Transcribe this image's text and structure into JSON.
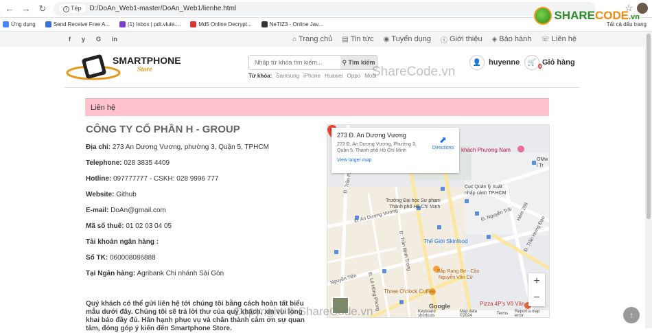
{
  "browser": {
    "url_chip": "Tệp",
    "url": "D:/DoAn_Web1-master/DoAn_Web1/lienhe.html",
    "bookmarks": [
      {
        "label": "Ứng dụng",
        "color": "#4285f4"
      },
      {
        "label": "Send Receive Free A...",
        "color": "#3b6fd9"
      },
      {
        "label": "(1) Inbox | pdt.vlute....",
        "color": "#7b3fd6"
      },
      {
        "label": "Md5 Online Decrypt...",
        "color": "#d33"
      },
      {
        "label": "NeTIZ3 - Online Jav...",
        "color": "#333"
      }
    ],
    "all_bookmarks": "Tất cả dấu trang"
  },
  "brand_logo": {
    "main": "SHARE",
    "accent": "CODE",
    "suffix": ".vn"
  },
  "topbar": {
    "social": [
      "f",
      "y",
      "G",
      "in"
    ],
    "nav": [
      {
        "icon": "home-icon",
        "glyph": "⌂",
        "label": "Trang chủ"
      },
      {
        "icon": "newspaper-icon",
        "glyph": "▤",
        "label": "Tin tức"
      },
      {
        "icon": "eye-icon",
        "glyph": "◉",
        "label": "Tuyển dụng"
      },
      {
        "icon": "info-icon",
        "glyph": "ⓘ",
        "label": "Giới thiệu"
      },
      {
        "icon": "tag-icon",
        "glyph": "◈",
        "label": "Bảo hành"
      },
      {
        "icon": "phone-icon",
        "glyph": "☏",
        "label": "Liên hệ"
      }
    ]
  },
  "header": {
    "logo_title": "SMARTPHONE",
    "logo_sub": "Store",
    "search_placeholder": "Nhập từ khóa tìm kiếm...",
    "search_button": "Tìm kiếm",
    "keywords_label": "Từ khóa:",
    "keywords": [
      "Samsung",
      "iPhone",
      "Huawei",
      "Oppo",
      "Mobi"
    ],
    "user": "huyenne",
    "cart_label": "Giỏ hàng",
    "cart_count": "0"
  },
  "watermark": "ShareCode.vn",
  "watermark_bottom": "Copyright © ShareCode.vn",
  "contact": {
    "banner": "Liên hệ",
    "company": "CÔNG TY CỔ PHẦN H - GROUP",
    "rows": [
      {
        "label": "Địa chỉ:",
        "value": "273 An Dương Vương, phường 3, Quận 5, TPHCM"
      },
      {
        "label": "Telephone:",
        "value": "028 3835 4409"
      },
      {
        "label": "Hotline:",
        "value": "097777777 - CSKH: 028 9996 777"
      },
      {
        "label": "Website:",
        "value": "Github"
      },
      {
        "label": "E-mail:",
        "value": "DoAn@gmail.com"
      },
      {
        "label": "Mã số thuế:",
        "value": "01 02 03 04 05"
      },
      {
        "label": "Tài khoản ngân hàng :",
        "value": ""
      },
      {
        "label": "Số TK:",
        "value": "060008086888"
      },
      {
        "label": "Tại Ngân hàng:",
        "value": "Agribank Chi nhánh Sài Gòn"
      }
    ],
    "paragraph": "Quý khách có thể gửi liên hệ tới chúng tôi bằng cách hoàn tất biểu mẫu dưới đây. Chúng tôi sẽ trả lời thư của quý khách, xin vui lòng khai báo đầy đủ. Hân hạnh phục vụ và chân thành cảm ơn sự quan tâm, đóng góp ý kiến đến Smartphone Store."
  },
  "map": {
    "place_title": "273 Đ. An Dương Vương",
    "place_address": "273 Đ. An Dương Vương, Phường 3, Quận 5, Thành phố Hồ Chí Minh",
    "directions": "Directions",
    "larger_map": "View larger map",
    "google": "Google",
    "footer": [
      "Keyboard shortcuts",
      "Map data ©2024",
      "Terms",
      "Report a map error"
    ],
    "labels": {
      "street_adv": "Đ. An Dương Vương",
      "street_trantri": "Đ. Trần Phú",
      "street_nguyentrai": "Đ. Nguyễn Trãi",
      "street_nguyenvancu": "Nguyễn Văn Cừ",
      "street_tranbinhtrong": "Đ. Trần Bình Trọng",
      "street_lehongphong": "Đ. Lê Hồng Phong",
      "street_tranhungdao": "Đ. Trần Hưng Đạo",
      "street_nguyentien": "Nguyễn Tiến",
      "street_hem": "Hẻm 268",
      "poi_phuongnam": "khách Phương Nam",
      "poi_university1": "Trường Đại học Sư phạm",
      "poi_university2": "Thành phố Hồ Chí Minh",
      "poi_cucquanly1": "Cục Quản lý Xuất",
      "poi_cucquanly2": "nhập cảnh TP.HCM",
      "poi_skinfood": "Thế Giới Skinfood",
      "poi_bapranh1": "Bắp Rang Bơ - Cầu",
      "poi_bapranh2": "Nguyễn Văn Cừ",
      "poi_threeoclock": "Three O'clock Coffee",
      "poi_pizza": "Pizza 4P's Võ Văn",
      "poi_omw1": "OMw",
      "poi_omw2": "l Tr"
    }
  }
}
